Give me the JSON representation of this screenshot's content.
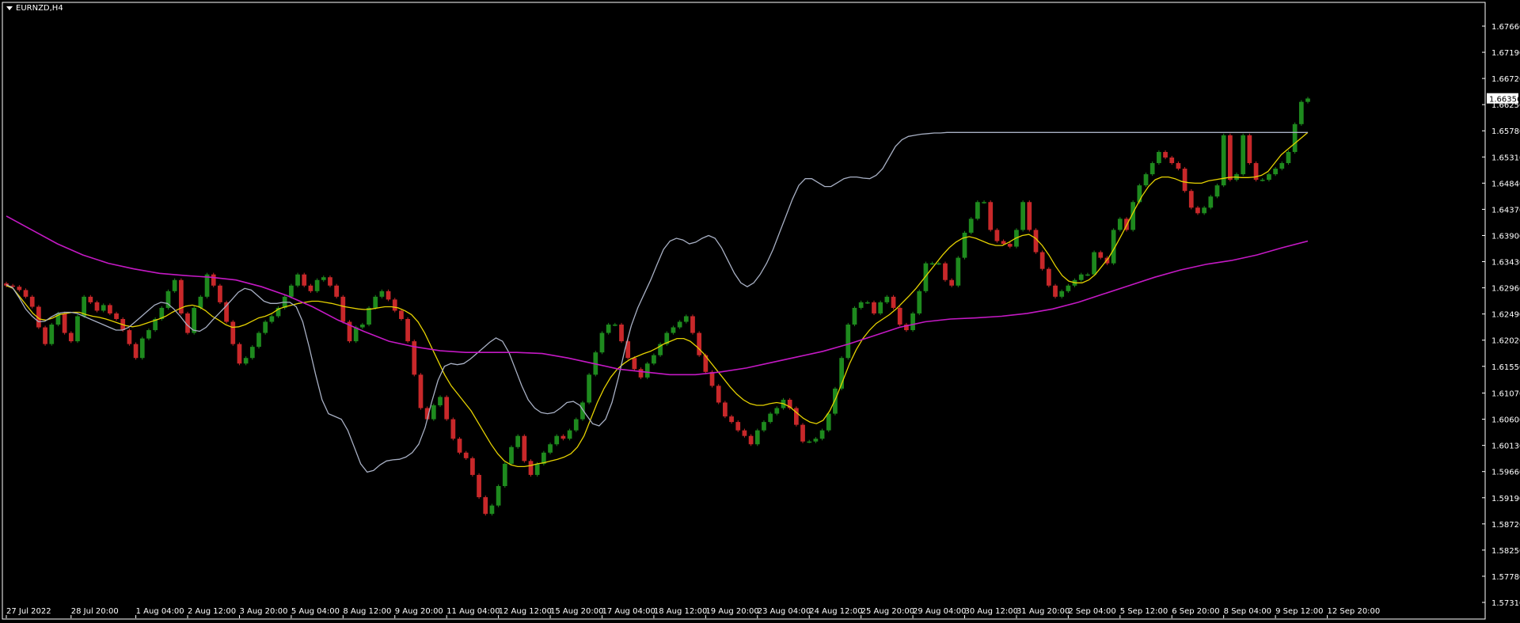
{
  "symbol": "EURNZD,H4",
  "icons": {
    "menu": "triangle-down-icon"
  },
  "colors": {
    "background": "#000000",
    "frame": "#ffffff",
    "bull": "#1e8a1e",
    "bear": "#c8282a",
    "ma_fast": "#e6d200",
    "ma_medium": "#a8b0c4",
    "ma_slow": "#c419c4",
    "price_label_bg": "#ffffff",
    "price_label_text": "#000000"
  },
  "chart_data": {
    "type": "candlestick",
    "y_ticks": [
      "1.67660",
      "1.67190",
      "1.66720",
      "1.66250",
      "1.65780",
      "1.65310",
      "1.64840",
      "1.64370",
      "1.63900",
      "1.63430",
      "1.62960",
      "1.62490",
      "1.62020",
      "1.61550",
      "1.61070",
      "1.60600",
      "1.60130",
      "1.59660",
      "1.59190",
      "1.58720",
      "1.58250",
      "1.57780",
      "1.57310"
    ],
    "ylim": [
      1.5731,
      1.6766
    ],
    "current_price": "1.66356",
    "x_ticks": [
      {
        "label": "27 Jul 2022",
        "bar": 0
      },
      {
        "label": "28 Jul 20:00",
        "bar": 10
      },
      {
        "label": "1 Aug 04:00",
        "bar": 20
      },
      {
        "label": "2 Aug 12:00",
        "bar": 28
      },
      {
        "label": "3 Aug 20:00",
        "bar": 36
      },
      {
        "label": "5 Aug 04:00",
        "bar": 44
      },
      {
        "label": "8 Aug 12:00",
        "bar": 52
      },
      {
        "label": "9 Aug 20:00",
        "bar": 60
      },
      {
        "label": "11 Aug 04:00",
        "bar": 68
      },
      {
        "label": "12 Aug 12:00",
        "bar": 76
      },
      {
        "label": "15 Aug 20:00",
        "bar": 84
      },
      {
        "label": "17 Aug 04:00",
        "bar": 92
      },
      {
        "label": "18 Aug 12:00",
        "bar": 100
      },
      {
        "label": "19 Aug 20:00",
        "bar": 108
      },
      {
        "label": "23 Aug 04:00",
        "bar": 116
      },
      {
        "label": "24 Aug 12:00",
        "bar": 124
      },
      {
        "label": "25 Aug 20:00",
        "bar": 132
      },
      {
        "label": "29 Aug 04:00",
        "bar": 140
      },
      {
        "label": "30 Aug 12:00",
        "bar": 148
      },
      {
        "label": "31 Aug 20:00",
        "bar": 156
      },
      {
        "label": "2 Sep 04:00",
        "bar": 164
      },
      {
        "label": "5 Sep 12:00",
        "bar": 172
      },
      {
        "label": "6 Sep 20:00",
        "bar": 180
      },
      {
        "label": "8 Sep 04:00",
        "bar": 188
      },
      {
        "label": "9 Sep 12:00",
        "bar": 196
      },
      {
        "label": "12 Sep 20:00",
        "bar": 204
      }
    ],
    "close": [
      1.63,
      1.6298,
      1.6292,
      1.628,
      1.6262,
      1.6225,
      1.6195,
      1.623,
      1.625,
      1.6215,
      1.62,
      1.6245,
      1.628,
      1.627,
      1.6255,
      1.6265,
      1.625,
      1.624,
      1.622,
      1.6195,
      1.617,
      1.6205,
      1.622,
      1.624,
      1.626,
      1.629,
      1.631,
      1.625,
      1.6215,
      1.626,
      1.628,
      1.632,
      1.63,
      1.627,
      1.6235,
      1.6195,
      1.616,
      1.617,
      1.619,
      1.6215,
      1.6235,
      1.6245,
      1.626,
      1.628,
      1.63,
      1.632,
      1.63,
      1.629,
      1.631,
      1.6315,
      1.63,
      1.628,
      1.6235,
      1.62,
      1.6225,
      1.623,
      1.626,
      1.628,
      1.629,
      1.6275,
      1.6255,
      1.624,
      1.62,
      1.614,
      1.608,
      1.606,
      1.6085,
      1.61,
      1.606,
      1.6025,
      1.6,
      1.599,
      1.596,
      1.592,
      1.589,
      1.5905,
      1.594,
      1.598,
      1.601,
      1.603,
      1.5985,
      1.596,
      1.598,
      1.6,
      1.6015,
      1.603,
      1.6025,
      1.604,
      1.606,
      1.609,
      1.614,
      1.618,
      1.6215,
      1.623,
      1.623,
      1.62,
      1.617,
      1.615,
      1.6135,
      1.616,
      1.6175,
      1.6195,
      1.6215,
      1.6225,
      1.6235,
      1.6245,
      1.6215,
      1.6175,
      1.6145,
      1.612,
      1.609,
      1.6065,
      1.6055,
      1.604,
      1.603,
      1.6015,
      1.604,
      1.6055,
      1.607,
      1.608,
      1.6095,
      1.608,
      1.605,
      1.602,
      1.602,
      1.6025,
      1.604,
      1.607,
      1.6115,
      1.617,
      1.623,
      1.626,
      1.627,
      1.627,
      1.625,
      1.627,
      1.628,
      1.626,
      1.623,
      1.622,
      1.625,
      1.629,
      1.634,
      1.634,
      1.634,
      1.631,
      1.63,
      1.635,
      1.6395,
      1.642,
      1.645,
      1.645,
      1.64,
      1.638,
      1.6375,
      1.637,
      1.64,
      1.645,
      1.64,
      1.636,
      1.633,
      1.63,
      1.628,
      1.629,
      1.63,
      1.631,
      1.632,
      1.632,
      1.636,
      1.635,
      1.634,
      1.64,
      1.642,
      1.64,
      1.645,
      1.648,
      1.65,
      1.652,
      1.654,
      1.653,
      1.652,
      1.651,
      1.647,
      1.644,
      1.643,
      1.644,
      1.646,
      1.648,
      1.657,
      1.649,
      1.65,
      1.657,
      1.652,
      1.649,
      1.649,
      1.65,
      1.651,
      1.652,
      1.654,
      1.659,
      1.663,
      1.6636
    ],
    "series": [
      {
        "name": "",
        "color_key": "ma_fast",
        "values": [
          1.63,
          1.6295,
          1.628,
          1.6265,
          1.625,
          1.624,
          1.6238,
          1.6242,
          1.6248,
          1.625,
          1.6252,
          1.6252,
          1.6248,
          1.6245,
          1.6243,
          1.624,
          1.6236,
          1.6232,
          1.6228,
          1.6226,
          1.6228,
          1.6232,
          1.6236,
          1.624,
          1.6245,
          1.6252,
          1.6258,
          1.6263,
          1.6265,
          1.6262,
          1.6255,
          1.6245,
          1.6238,
          1.623,
          1.6225,
          1.6226,
          1.623,
          1.6236,
          1.6242,
          1.6245,
          1.625,
          1.6258,
          1.6262,
          1.6265,
          1.6268,
          1.627,
          1.6272,
          1.6272,
          1.627,
          1.6268,
          1.6265,
          1.6262,
          1.626,
          1.6258,
          1.6257,
          1.6258,
          1.626,
          1.6262,
          1.6262,
          1.626,
          1.6255,
          1.6248,
          1.6235,
          1.6215,
          1.619,
          1.6165,
          1.614,
          1.612,
          1.6105,
          1.609,
          1.6075,
          1.6055,
          1.6035,
          1.6015,
          1.5998,
          1.5985,
          1.5978,
          1.5975,
          1.5975,
          1.5977,
          1.598,
          1.5982,
          1.5985,
          1.5988,
          1.5992,
          1.5998,
          1.601,
          1.603,
          1.606,
          1.609,
          1.6115,
          1.6135,
          1.615,
          1.616,
          1.6168,
          1.6173,
          1.6178,
          1.6182,
          1.6188,
          1.6195,
          1.62,
          1.6205,
          1.6205,
          1.62,
          1.619,
          1.6178,
          1.6163,
          1.6148,
          1.6133,
          1.6118,
          1.6105,
          1.6095,
          1.6088,
          1.6085,
          1.6085,
          1.6088,
          1.609,
          1.6088,
          1.6082,
          1.6072,
          1.6062,
          1.6055,
          1.6052,
          1.6058,
          1.6075,
          1.61,
          1.613,
          1.616,
          1.6185,
          1.6205,
          1.622,
          1.6232,
          1.624,
          1.6248,
          1.6258,
          1.627,
          1.6282,
          1.6295,
          1.631,
          1.6325,
          1.634,
          1.6355,
          1.6368,
          1.6378,
          1.6385,
          1.6388,
          1.6385,
          1.638,
          1.6375,
          1.6372,
          1.6372,
          1.6378,
          1.6385,
          1.639,
          1.6392,
          1.6385,
          1.6372,
          1.6355,
          1.6335,
          1.6318,
          1.6308,
          1.6305,
          1.6305,
          1.631,
          1.632,
          1.6335,
          1.635,
          1.637,
          1.6392,
          1.6415,
          1.6438,
          1.646,
          1.6478,
          1.649,
          1.6495,
          1.6495,
          1.6492,
          1.6487,
          1.6485,
          1.6484,
          1.6484,
          1.6488,
          1.649,
          1.6492,
          1.6494,
          1.6495,
          1.6494,
          1.6494,
          1.6495,
          1.6498,
          1.6505,
          1.652,
          1.6535,
          1.6545,
          1.6555,
          1.6565,
          1.6575
        ]
      },
      {
        "name": "",
        "color_key": "ma_medium",
        "values": [
          1.6302,
          1.6296,
          1.6278,
          1.6258,
          1.6245,
          1.6235,
          1.6236,
          1.6244,
          1.625,
          1.6252,
          1.6252,
          1.625,
          1.6245,
          1.624,
          1.6235,
          1.623,
          1.6225,
          1.622,
          1.622,
          1.6225,
          1.6235,
          1.6245,
          1.6255,
          1.6265,
          1.627,
          1.6268,
          1.6258,
          1.6245,
          1.623,
          1.622,
          1.6218,
          1.6225,
          1.6238,
          1.625,
          1.6262,
          1.6275,
          1.6288,
          1.6295,
          1.6292,
          1.6282,
          1.6272,
          1.6268,
          1.6268,
          1.627,
          1.627,
          1.6262,
          1.6235,
          1.619,
          1.614,
          1.6095,
          1.607,
          1.6065,
          1.606,
          1.604,
          1.601,
          1.598,
          1.5965,
          1.5968,
          1.5978,
          1.5985,
          1.5987,
          1.5988,
          1.5992,
          1.6,
          1.6015,
          1.6045,
          1.609,
          1.613,
          1.6155,
          1.616,
          1.6158,
          1.616,
          1.6168,
          1.6178,
          1.6188,
          1.6198,
          1.6206,
          1.62,
          1.618,
          1.615,
          1.612,
          1.6095,
          1.608,
          1.6072,
          1.607,
          1.6072,
          1.608,
          1.609,
          1.6092,
          1.6085,
          1.6068,
          1.6052,
          1.6048,
          1.606,
          1.609,
          1.6135,
          1.6185,
          1.6228,
          1.626,
          1.6285,
          1.631,
          1.6338,
          1.6365,
          1.638,
          1.6385,
          1.6382,
          1.6375,
          1.6378,
          1.6385,
          1.639,
          1.6385,
          1.6368,
          1.6345,
          1.6322,
          1.6305,
          1.6298,
          1.6305,
          1.632,
          1.634,
          1.6365,
          1.6395,
          1.6425,
          1.6455,
          1.648,
          1.6492,
          1.6492,
          1.6485,
          1.6478,
          1.6478,
          1.6485,
          1.6492,
          1.6495,
          1.6495,
          1.6493,
          1.6492,
          1.6498,
          1.651,
          1.653,
          1.655,
          1.6562,
          1.6568,
          1.657,
          1.6572,
          1.6573,
          1.6574,
          1.6574,
          1.6575,
          1.6575,
          1.6575,
          1.6575,
          1.6575,
          1.6575,
          1.6575,
          1.6575,
          1.6575,
          1.6575,
          1.6575,
          1.6575,
          1.6575,
          1.6575,
          1.6575,
          1.6575,
          1.6575,
          1.6575,
          1.6575,
          1.6575,
          1.6575,
          1.6575,
          1.6575,
          1.6575,
          1.6575,
          1.6575,
          1.6575,
          1.6575,
          1.6575,
          1.6575,
          1.6575,
          1.6575,
          1.6575,
          1.6575,
          1.6575,
          1.6575,
          1.6575,
          1.6575,
          1.6575,
          1.6575,
          1.6575,
          1.6575,
          1.6575,
          1.6575,
          1.6575,
          1.6575,
          1.6575,
          1.6575,
          1.6575,
          1.6575,
          1.6575,
          1.6575,
          1.6575,
          1.6575,
          1.6575,
          1.6575,
          1.6575
        ]
      },
      {
        "name": "",
        "color_key": "ma_slow",
        "values": [
          1.6425,
          1.64,
          1.6375,
          1.6355,
          1.634,
          1.633,
          1.6322,
          1.6318,
          1.6315,
          1.631,
          1.6298,
          1.6282,
          1.6262,
          1.6238,
          1.6218,
          1.62,
          1.619,
          1.6183,
          1.618,
          1.618,
          1.618,
          1.6178,
          1.617,
          1.616,
          1.615,
          1.6145,
          1.614,
          1.614,
          1.6145,
          1.6152,
          1.6162,
          1.6172,
          1.6182,
          1.6195,
          1.621,
          1.6225,
          1.6235,
          1.624,
          1.6242,
          1.6245,
          1.625,
          1.6258,
          1.627,
          1.6285,
          1.63,
          1.6315,
          1.6328,
          1.6338,
          1.6345,
          1.6355,
          1.6368,
          1.638
        ]
      }
    ]
  }
}
